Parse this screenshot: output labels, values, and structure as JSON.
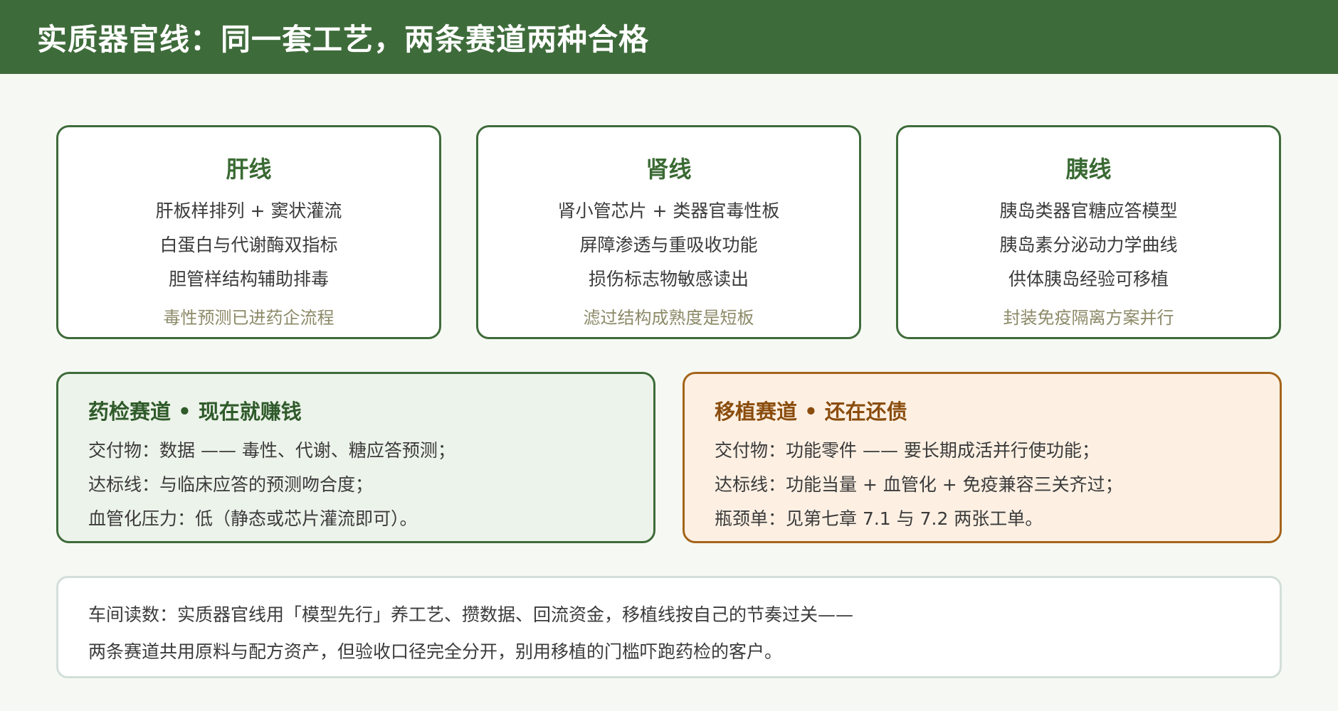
{
  "header": {
    "title": "实质器官线：同一套工艺，两条赛道两种合格"
  },
  "lines": [
    {
      "title": "肝线",
      "features": [
        "肝板样排列 + 窦状灌流",
        "白蛋白与代谢酶双指标",
        "胆管样结构辅助排毒"
      ],
      "note": "毒性预测已进药企流程"
    },
    {
      "title": "肾线",
      "features": [
        "肾小管芯片 + 类器官毒性板",
        "屏障渗透与重吸收功能",
        "损伤标志物敏感读出"
      ],
      "note": "滤过结构成熟度是短板"
    },
    {
      "title": "胰线",
      "features": [
        "胰岛类器官糖应答模型",
        "胰岛素分泌动力学曲线",
        "供体胰岛经验可移植"
      ],
      "note": "封装免疫隔离方案并行"
    }
  ],
  "tracks": {
    "drug": {
      "title": "药检赛道 • 现在就赚钱",
      "lines": [
        "交付物：数据 —— 毒性、代谢、糖应答预测；",
        "达标线：与临床应答的预测吻合度；",
        "血管化压力：低（静态或芯片灌流即可）。"
      ],
      "color": "#3e6b3a"
    },
    "transplant": {
      "title": "移植赛道 • 还在还债",
      "lines": [
        "交付物：功能零件 —— 要长期成活并行使功能；",
        "达标线：功能当量 + 血管化 + 免疫兼容三关齐过；",
        "瓶颈单：见第七章 7.1 与 7.2 两张工单。"
      ],
      "color": "#a5641a"
    }
  },
  "reading": {
    "lines": [
      "车间读数：实质器官线用「模型先行」养工艺、攒数据、回流资金，移植线按自己的节奏过关——",
      "两条赛道共用原料与配方资产，但验收口径完全分开，别用移植的门槛吓跑药检的客户。"
    ]
  }
}
